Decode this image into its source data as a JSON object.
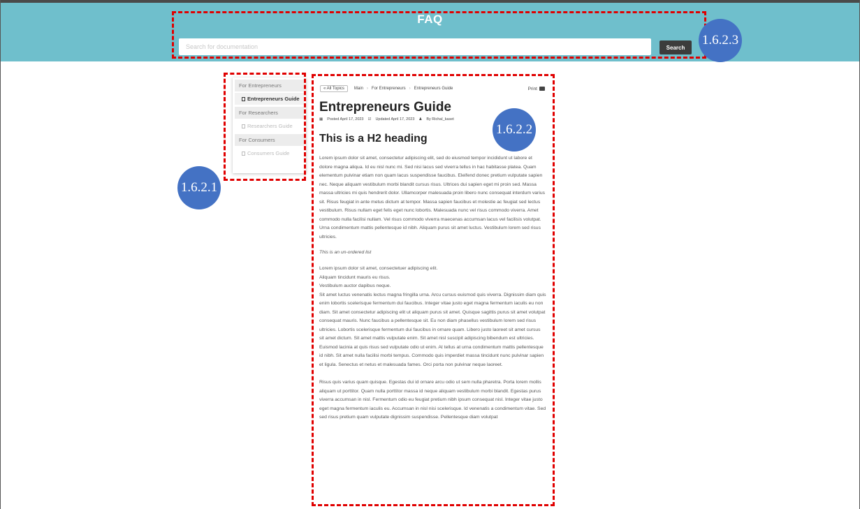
{
  "header": {
    "title": "FAQ",
    "search_placeholder": "Search for documentation",
    "search_button": "Search",
    "color": "#6fbfcc"
  },
  "annotations": {
    "search_area": "1.6.2.3",
    "article_area": "1.6.2.2",
    "sidebar_area": "1.6.2.1",
    "dash_color": "#e00000",
    "badge_color": "#4472c4"
  },
  "sidebar": {
    "sections": [
      {
        "label": "For Entrepreneurs",
        "item": "Entrepreneurs Guide"
      },
      {
        "label": "For Researchers",
        "item": "Researchers Guide"
      },
      {
        "label": "For Consumers",
        "item": "Consumers Guide"
      }
    ]
  },
  "breadcrumb": {
    "all_topics": "« All Topics",
    "items": [
      "Main",
      "For Entrepreneurs",
      "Entrepreneurs Guide"
    ],
    "print": "Print"
  },
  "article": {
    "title": "Entrepreneurs Guide",
    "posted": "Posted April 17, 2023",
    "updated": "Updated April 17, 2023",
    "author": "By Richal_kaset",
    "h2": "This is a H2 heading",
    "paragraph1": "Lorem ipsum dolor sit amet, consectetur adipiscing elit, sed do eiusmod tempor incididunt ut labore et dolore magna aliqua. Id eu nisl nunc mi. Sed nisi lacus sed viverra tellus in hac habitasse platea. Quam elementum pulvinar etiam non quam lacus suspendisse faucibus. Eleifend donec pretium vulputate sapien nec. Neque aliquam vestibulum morbi blandit cursus risus. Ultrices dui sapien eget mi proin sed. Massa massa ultricies mi quis hendrerit dolor. Ullamcorper malesuada proin libero nunc consequat interdum varius sit. Risus feugiat in ante metus dictum at tempor. Massa sapien faucibus et molestie ac feugiat sed lectus vestibulum. Risus nullam eget felis eget nunc lobortis. Malesuada nunc vel risus commodo viverra. Amet commodo nulla facilisi nullam. Vel risus commodo viverra maecenas accumsan lacus vel facilisis volutpat. Urna condimentum mattis pellentesque id nibh. Aliquam purus sit amet luctus. Vestibulum lorem sed risus ultricies.",
    "list_title": "This is an un-ordered list",
    "list": [
      "Lorem ipsum dolor sit amet, consectetuer adipiscing elit.",
      "Aliquam tincidunt mauris eu risus.",
      "Vestibulum auctor dapibus neque."
    ],
    "paragraph2": "Sit amet luctus venenatis lectus magna fringilla urna. Arcu cursus euismod quis viverra. Dignissim diam quis enim lobortis scelerisque fermentum dui faucibus. Integer vitae justo eget magna fermentum iaculis eu non diam. Sit amet consectetur adipiscing elit ut aliquam purus sit amet. Quisque sagittis purus sit amet volutpat consequat mauris. Nunc faucibus a pellentesque sit. Eu non diam phasellus vestibulum lorem sed risus ultricies. Lobortis scelerisque fermentum dui faucibus in ornare quam. Libero justo laoreet sit amet cursus sit amet dictum. Sit amet mattis vulputate enim. Sit amet nisl suscipit adipiscing bibendum est ultricies. Euismod lacinia at quis risus sed vulputate odio ut enim. At tellus at urna condimentum mattis pellentesque id nibh. Sit amet nulla facilisi morbi tempus. Commodo quis imperdiet massa tincidunt nunc pulvinar sapien et ligula. Senectus et netus et malesuada fames. Orci porta non pulvinar neque laoreet.",
    "paragraph3": "Risus quis varius quam quisque. Egestas dui id ornare arcu odio ut sem nulla pharetra. Porta lorem mollis aliquam ut porttitor. Quam nulla porttitor massa id neque aliquam vestibulum morbi blandit. Egestas purus viverra accumsan in nisl. Fermentum odio eu feugiat pretium nibh ipsum consequat nisl. Integer vitae justo eget magna fermentum iaculis eu. Accumsan in nisl nisi scelerisque. Id venenatis a condimentum vitae. Sed sed risus pretium quam vulputate dignissim suspendisse. Pellentesque diam volutpat"
  }
}
